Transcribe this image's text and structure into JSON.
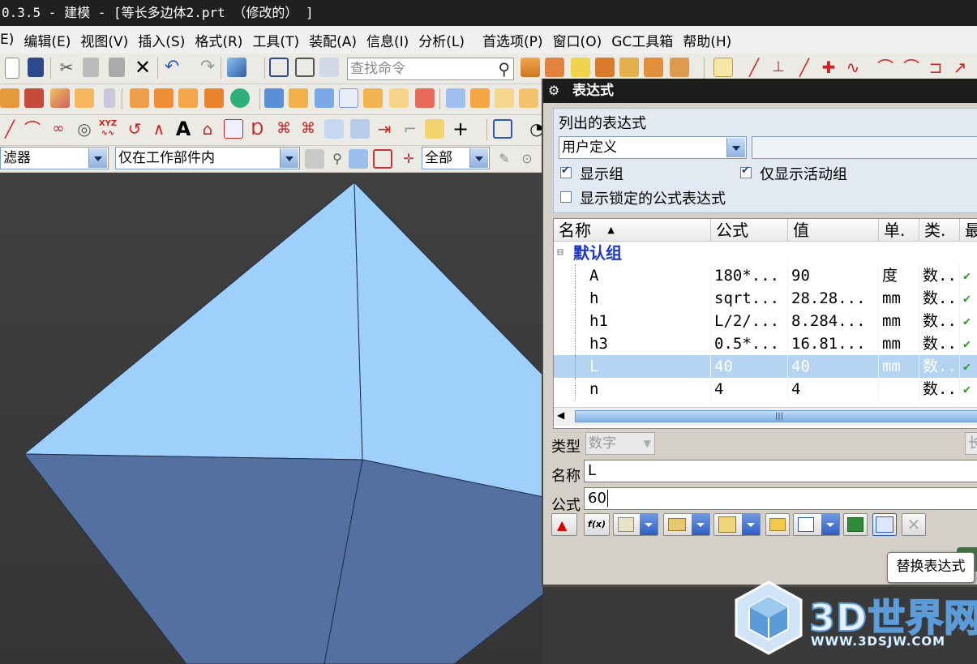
{
  "window": {
    "title": "0.3.5 - 建模 - [等长多边体2.prt （修改的） ]"
  },
  "menu": [
    "E)",
    "编辑(E)",
    "视图(V)",
    "插入(S)",
    "格式(R)",
    "工具(T)",
    "装配(A)",
    "信息(I)",
    "分析(L)",
    "首选项(P)",
    "窗口(O)",
    "GC工具箱",
    "帮助(H)"
  ],
  "toolbar": {
    "search_placeholder": "查找命令",
    "filter_label": "滤器",
    "scope_value": "仅在工作部件内",
    "all_value": "全部",
    "text_glyph": "A",
    "xyz_label": "XYZ"
  },
  "dialog": {
    "title": "表达式",
    "listed_label": "列出的表达式",
    "listed_value": "用户定义",
    "show_groups": "显示组",
    "only_active": "仅显示活动组",
    "show_locked": "显示锁定的公式表达式",
    "columns": [
      "名称",
      "公式",
      "值",
      "单.",
      "类.",
      "最"
    ],
    "group_name": "默认组",
    "rows": [
      {
        "name": "A",
        "formula": "180*...",
        "value": "90",
        "unit": "度",
        "type": "数..",
        "flag": "✔"
      },
      {
        "name": "h",
        "formula": "sqrt...",
        "value": "28.28...",
        "unit": "mm",
        "type": "数..",
        "flag": "✔"
      },
      {
        "name": "h1",
        "formula": "L/2/...",
        "value": "8.284...",
        "unit": "mm",
        "type": "数..",
        "flag": "✔"
      },
      {
        "name": "h3",
        "formula": "0.5*...",
        "value": "16.81...",
        "unit": "mm",
        "type": "数..",
        "flag": "✔"
      },
      {
        "name": "L",
        "formula": "40",
        "value": "40",
        "unit": "mm",
        "type": "数..",
        "flag": "✔"
      },
      {
        "name": "n",
        "formula": "4",
        "value": "4",
        "unit": "",
        "type": "数..",
        "flag": "✔"
      }
    ],
    "selected_row": 4,
    "type_label": "类型",
    "type_value": "数字",
    "name_label": "名称",
    "name_value": "L",
    "formula_label": "公式",
    "formula_value": "60",
    "fx_label": "f(x)",
    "tooltip": "替换表达式",
    "right_cut_label": "长"
  },
  "watermark": {
    "brand": "3D世界网",
    "url": "WWW.3DSJW.COM"
  },
  "colors": {
    "face_light": "#9fd0fb",
    "face_dark": "#5470a0",
    "selection": "#b4d4f2"
  }
}
